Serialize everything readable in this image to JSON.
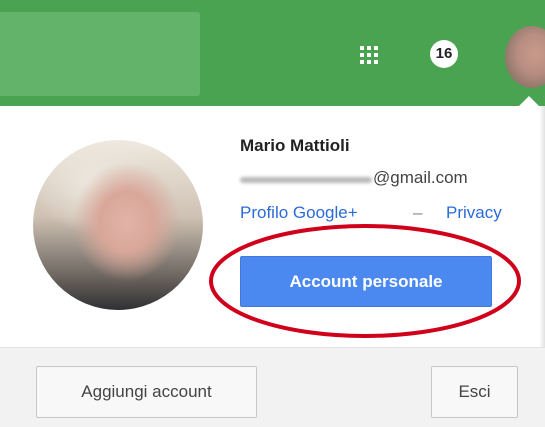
{
  "header": {
    "apps_icon": "apps-grid-icon",
    "notification_count": "16",
    "avatar": "user-avatar"
  },
  "account": {
    "name": "Mario Mattioli",
    "email_suffix": "@gmail.com",
    "profile_link": "Profilo Google+",
    "separator": "–",
    "privacy_link": "Privacy",
    "primary_button": "Account personale"
  },
  "footer": {
    "add_account": "Aggiungi account",
    "sign_out": "Esci"
  },
  "colors": {
    "header_bg": "#4aa351",
    "primary_button": "#4b89f0",
    "link": "#2b6bd8",
    "annotation": "#d0021b"
  }
}
